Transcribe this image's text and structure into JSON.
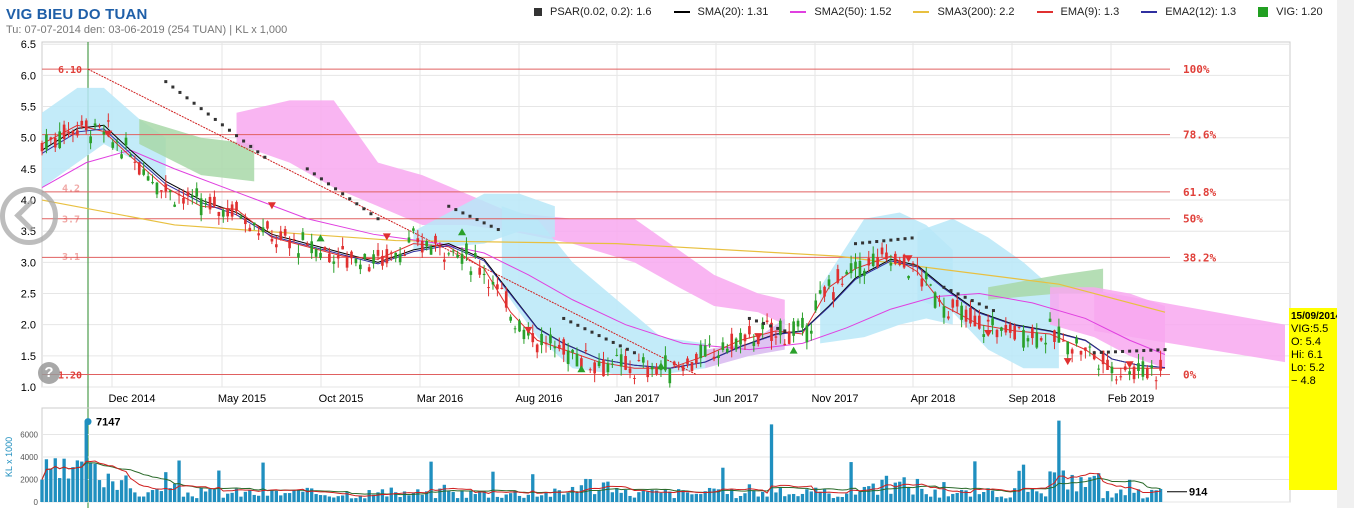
{
  "header": {
    "title": "VIG BIEU DO TUAN",
    "subtitle": "Tu: 07-07-2014 den: 03-06-2019 (254 TUAN) | KL x 1,000"
  },
  "legend": [
    {
      "label": "PSAR(0.02, 0.2): 1.6",
      "color": "#333333",
      "kind": "sq"
    },
    {
      "label": "SMA(20): 1.31",
      "color": "#000000",
      "kind": "ln"
    },
    {
      "label": "SMA2(50): 1.52",
      "color": "#e040e0",
      "kind": "ln"
    },
    {
      "label": "SMA3(200): 2.2",
      "color": "#e8c040",
      "kind": "ln"
    },
    {
      "label": "EMA(9): 1.3",
      "color": "#e03030",
      "kind": "ln"
    },
    {
      "label": "EMA2(12): 1.3",
      "color": "#3030a0",
      "kind": "ln"
    },
    {
      "label": "VIG: 1.20",
      "color": "#22a022",
      "kind": "box"
    }
  ],
  "info_box": {
    "date": "15/09/2014",
    "symbol_line": "VIG:5.5",
    "open": "O: 5.4",
    "high": "Hi: 6.1",
    "low": "Lo: 5.2",
    "change": "− 4.8"
  },
  "help": {
    "label": "?"
  },
  "colors": {
    "up": "#2aa02a",
    "down": "#e03030",
    "cloud_bull": "#b8e8f8",
    "cloud_bear": "#f8a8f0",
    "fib": "#e06060",
    "volume": "#1f8fbf",
    "grid": "#e6e6e6"
  },
  "chart_data": [
    {
      "type": "candlestick",
      "title": "VIG BIEU DO TUAN",
      "y_range": [
        1.0,
        6.6
      ],
      "y_ticks": [
        "1.0",
        "1.5",
        "2.0",
        "2.5",
        "3.0",
        "3.5",
        "4.0",
        "4.5",
        "5.0",
        "5.5",
        "6.0",
        "6.5"
      ],
      "x_tick_labels": [
        "Dec 2014",
        "May 2015",
        "Oct 2015",
        "Mar 2016",
        "Aug 2016",
        "Jan 2017",
        "Jun 2017",
        "Nov 2017",
        "Apr 2018",
        "Sep 2018",
        "Feb 2019"
      ],
      "fibonacci": {
        "high": 6.1,
        "low": 1.2,
        "high_label": "6.10",
        "low_label": "1.20",
        "levels": [
          {
            "pct": "100%",
            "value": 6.1
          },
          {
            "pct": "78.6%",
            "value": 5.05
          },
          {
            "pct": "61.8%",
            "value": 4.13
          },
          {
            "pct": "50%",
            "value": 3.7
          },
          {
            "pct": "38.2%",
            "value": 3.08
          },
          {
            "pct": "0%",
            "value": 1.2
          }
        ],
        "faint_labels": [
          "5.1",
          "4.2",
          "3.7",
          "3.1"
        ]
      },
      "sma200": [
        [
          0,
          4.0
        ],
        [
          30,
          3.6
        ],
        [
          80,
          3.35
        ],
        [
          130,
          3.3
        ],
        [
          180,
          3.1
        ],
        [
          230,
          2.65
        ],
        [
          254,
          2.2
        ]
      ],
      "sma20": [
        [
          0,
          4.8
        ],
        [
          8,
          5.15
        ],
        [
          14,
          5.2
        ],
        [
          20,
          4.8
        ],
        [
          28,
          4.3
        ],
        [
          36,
          4.0
        ],
        [
          44,
          3.8
        ],
        [
          52,
          3.45
        ],
        [
          60,
          3.3
        ],
        [
          68,
          3.15
        ],
        [
          76,
          3.0
        ],
        [
          84,
          3.2
        ],
        [
          92,
          3.3
        ],
        [
          100,
          3.05
        ],
        [
          106,
          2.5
        ],
        [
          112,
          1.95
        ],
        [
          118,
          1.7
        ],
        [
          126,
          1.45
        ],
        [
          134,
          1.35
        ],
        [
          142,
          1.3
        ],
        [
          150,
          1.4
        ],
        [
          158,
          1.65
        ],
        [
          166,
          1.85
        ],
        [
          172,
          1.9
        ],
        [
          178,
          2.3
        ],
        [
          184,
          2.75
        ],
        [
          192,
          3.05
        ],
        [
          198,
          2.95
        ],
        [
          204,
          2.6
        ],
        [
          212,
          2.2
        ],
        [
          220,
          2.0
        ],
        [
          228,
          1.9
        ],
        [
          236,
          1.75
        ],
        [
          242,
          1.45
        ],
        [
          248,
          1.35
        ],
        [
          254,
          1.31
        ]
      ],
      "sma50": [
        [
          0,
          4.2
        ],
        [
          10,
          4.6
        ],
        [
          20,
          4.8
        ],
        [
          30,
          4.5
        ],
        [
          45,
          4.1
        ],
        [
          60,
          3.7
        ],
        [
          75,
          3.45
        ],
        [
          90,
          3.3
        ],
        [
          100,
          3.15
        ],
        [
          110,
          2.8
        ],
        [
          120,
          2.4
        ],
        [
          132,
          2.0
        ],
        [
          145,
          1.7
        ],
        [
          160,
          1.6
        ],
        [
          172,
          1.7
        ],
        [
          182,
          1.95
        ],
        [
          192,
          2.25
        ],
        [
          202,
          2.45
        ],
        [
          212,
          2.5
        ],
        [
          224,
          2.35
        ],
        [
          236,
          2.1
        ],
        [
          246,
          1.75
        ],
        [
          254,
          1.52
        ]
      ],
      "ema9": [
        [
          0,
          4.9
        ],
        [
          8,
          5.2
        ],
        [
          14,
          5.1
        ],
        [
          20,
          4.7
        ],
        [
          28,
          4.2
        ],
        [
          36,
          3.9
        ],
        [
          44,
          3.85
        ],
        [
          52,
          3.4
        ],
        [
          60,
          3.25
        ],
        [
          68,
          3.1
        ],
        [
          76,
          3.05
        ],
        [
          84,
          3.3
        ],
        [
          92,
          3.25
        ],
        [
          100,
          2.9
        ],
        [
          106,
          2.2
        ],
        [
          112,
          1.75
        ],
        [
          118,
          1.6
        ],
        [
          126,
          1.4
        ],
        [
          134,
          1.3
        ],
        [
          142,
          1.3
        ],
        [
          150,
          1.5
        ],
        [
          158,
          1.75
        ],
        [
          166,
          1.9
        ],
        [
          172,
          1.85
        ],
        [
          178,
          2.6
        ],
        [
          184,
          2.9
        ],
        [
          192,
          3.1
        ],
        [
          198,
          2.85
        ],
        [
          204,
          2.3
        ],
        [
          212,
          2.0
        ],
        [
          220,
          1.9
        ],
        [
          228,
          1.85
        ],
        [
          236,
          1.6
        ],
        [
          242,
          1.3
        ],
        [
          248,
          1.3
        ],
        [
          254,
          1.3
        ]
      ],
      "volume_panel": {
        "ylabel": "KL x 1000",
        "y_ticks": [
          "0",
          "2000",
          "4000",
          "6000"
        ],
        "peak_label": "7147",
        "last_label": "914"
      }
    }
  ]
}
